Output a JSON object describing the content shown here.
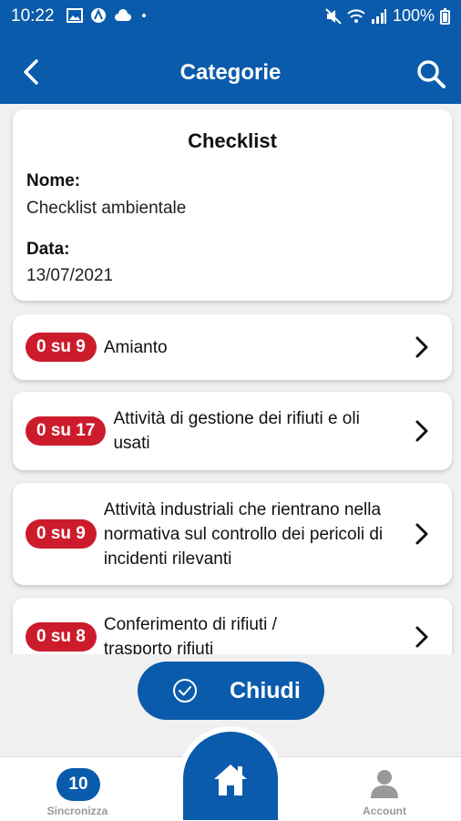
{
  "status": {
    "time": "10:22",
    "battery": "100%"
  },
  "header": {
    "title": "Categorie"
  },
  "checklist": {
    "heading": "Checklist",
    "name_label": "Nome:",
    "name_value": "Checklist ambientale",
    "date_label": "Data:",
    "date_value": "13/07/2021"
  },
  "categories": [
    {
      "badge": "0 su 9",
      "label": "Amianto"
    },
    {
      "badge": "0 su 17",
      "label": "Attività di gestione dei rifiuti e oli usati"
    },
    {
      "badge": "0 su 9",
      "label": "Attività industriali che rientrano nella normativa sul controllo dei pericoli di incidenti rilevanti"
    },
    {
      "badge": "0 su 8",
      "label": "Conferimento di rifiuti / trasporto rifiuti"
    }
  ],
  "close_button": {
    "label": "Chiudi"
  },
  "nav": {
    "sync_count": "10",
    "sync_label": "Sincronizza",
    "account_label": "Account"
  },
  "colors": {
    "primary": "#0a5bab",
    "badge": "#cc1c2c",
    "background": "#f0f0f0"
  }
}
